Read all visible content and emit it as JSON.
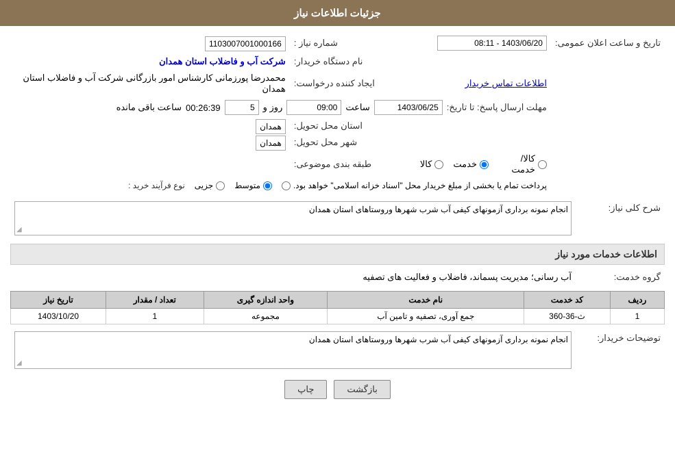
{
  "header": {
    "title": "جزئیات اطلاعات نیاز"
  },
  "fields": {
    "need_number_label": "شماره نیاز :",
    "need_number_value": "1103007001000166",
    "requester_label": "نام دستگاه خریدار:",
    "requester_value": "شرکت آب و فاضلاب استان همدان",
    "creator_label": "ایجاد کننده درخواست:",
    "creator_person": "محمدرضا پورزمانی کارشناس امور بازرگانی شرکت آب و فاضلاب استان همدان",
    "creator_link": "اطلاعات تماس خریدار",
    "announce_date_label": "تاریخ و ساعت اعلان عمومی:",
    "announce_date_value": "1403/06/20 - 08:11",
    "deadline_label": "مهلت ارسال پاسخ: تا تاریخ:",
    "deadline_date": "1403/06/25",
    "deadline_time_label": "ساعت",
    "deadline_time": "09:00",
    "deadline_days_label": "روز و",
    "deadline_days": "5",
    "deadline_remaining_label": "ساعت باقی مانده",
    "deadline_remaining": "00:26:39",
    "province_label": "استان محل تحویل:",
    "province_value": "همدان",
    "city_label": "شهر محل تحویل:",
    "city_value": "همدان",
    "category_label": "طبقه بندی موضوعی:",
    "category_options": [
      "کالا",
      "خدمت",
      "کالا/خدمت"
    ],
    "category_selected": "خدمت",
    "purchase_type_label": "نوع فرآیند خرید :",
    "purchase_types": [
      "جزیی",
      "متوسط",
      "پرداخت تمام یا بخشی از مبلغ خریدار محل \"اسناد خزانه اسلامی\" خواهد بود."
    ],
    "purchase_selected": "متوسط",
    "description_label": "شرح کلی نیاز:",
    "description_value": "انجام نمونه برداری آزمونهای کیفی آب شرب شهرها وروستاهای استان همدان",
    "services_section_label": "اطلاعات خدمات مورد نیاز",
    "service_group_label": "گروه خدمت:",
    "service_group_value": "آب رسانی؛ مدیریت پسماند، فاضلاب و فعالیت های تصفیه",
    "table_headers": [
      "ردیف",
      "کد خدمت",
      "نام خدمت",
      "واحد اندازه گیری",
      "تعداد / مقدار",
      "تاریخ نیاز"
    ],
    "table_rows": [
      {
        "row": "1",
        "code": "ث-36-360",
        "name": "جمع آوری، تصفیه و تامین آب",
        "unit": "مجموعه",
        "count": "1",
        "date": "1403/10/20"
      }
    ],
    "buyer_notes_label": "توضیحات خریدار:",
    "buyer_notes_value": "انجام نمونه برداری آزمونهای کیفی آب شرب شهرها وروستاهای استان همدان"
  },
  "buttons": {
    "print": "چاپ",
    "back": "بازگشت"
  }
}
